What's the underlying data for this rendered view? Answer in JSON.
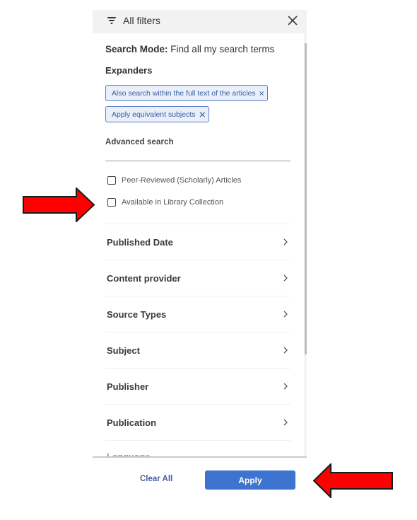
{
  "panel": {
    "title": "All filters",
    "close_label": "Close",
    "search_mode": {
      "label": "Search Mode:",
      "value": "Find all my search terms"
    },
    "expanders": {
      "label": "Expanders",
      "chips": [
        {
          "label": "Also search within the full text of the articles"
        },
        {
          "label": "Apply equivalent subjects"
        }
      ]
    },
    "advanced_search": {
      "label": "Advanced search",
      "value": ""
    },
    "checkboxes": [
      {
        "label": "Peer-Reviewed (Scholarly) Articles",
        "checked": false
      },
      {
        "label": "Available in Library Collection",
        "checked": false
      }
    ],
    "facets": [
      {
        "label": "Published Date"
      },
      {
        "label": "Content provider"
      },
      {
        "label": "Source Types"
      },
      {
        "label": "Subject"
      },
      {
        "label": "Publisher"
      },
      {
        "label": "Publication"
      },
      {
        "label": "Language"
      }
    ]
  },
  "footer": {
    "clear_label": "Clear All",
    "apply_label": "Apply"
  },
  "colors": {
    "accent": "#3d74cf",
    "chip_border": "#5a7fc4",
    "chip_bg": "#e9f0fb",
    "annotation_arrow": "#ff0000"
  }
}
